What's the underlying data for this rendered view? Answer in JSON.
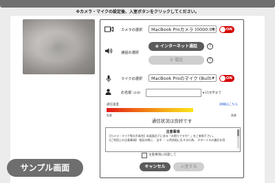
{
  "notice": "※カメラ・マイクの設定後、入室ボタンをクリックしてください。",
  "camera": {
    "label": "カメラの選択",
    "selected": "MacBook Proカメラ (0000:00",
    "toggle": "ON"
  },
  "speaker": {
    "label": "通話の選択",
    "internet_button": "インターネット通話",
    "phone_button": "電話"
  },
  "mic": {
    "label": "マイクの選択",
    "selected": "MacBook Proのマイク (Built-",
    "toggle": "ON"
  },
  "name": {
    "label": "お名前",
    "required_tag": "(必須)",
    "hint": "★15文字まで"
  },
  "quality": {
    "label": "通信速度",
    "details_link": "詳細はこちら",
    "low": "低速",
    "high": "高速",
    "status": "通信状況は良好です"
  },
  "terms": {
    "title": "注意事項",
    "lines": [
      "【カメラ・マイク等の不具合】本画面右下にある「お困りですか？」をご参照下さい。",
      "【ご利用上の注意事項】 他証の際に、 法令 ・ 公序良俗に反する行為、 ホターイスの違反を用"
    ],
    "agree_label": "注意事項に同意して"
  },
  "buttons": {
    "cancel": "キャンセル",
    "enter": "入室する"
  },
  "overlay": {
    "sample": "サンプル画面"
  },
  "colors": {
    "toggle_on": "#d60000",
    "accent_dark": "#5b5b5b"
  }
}
